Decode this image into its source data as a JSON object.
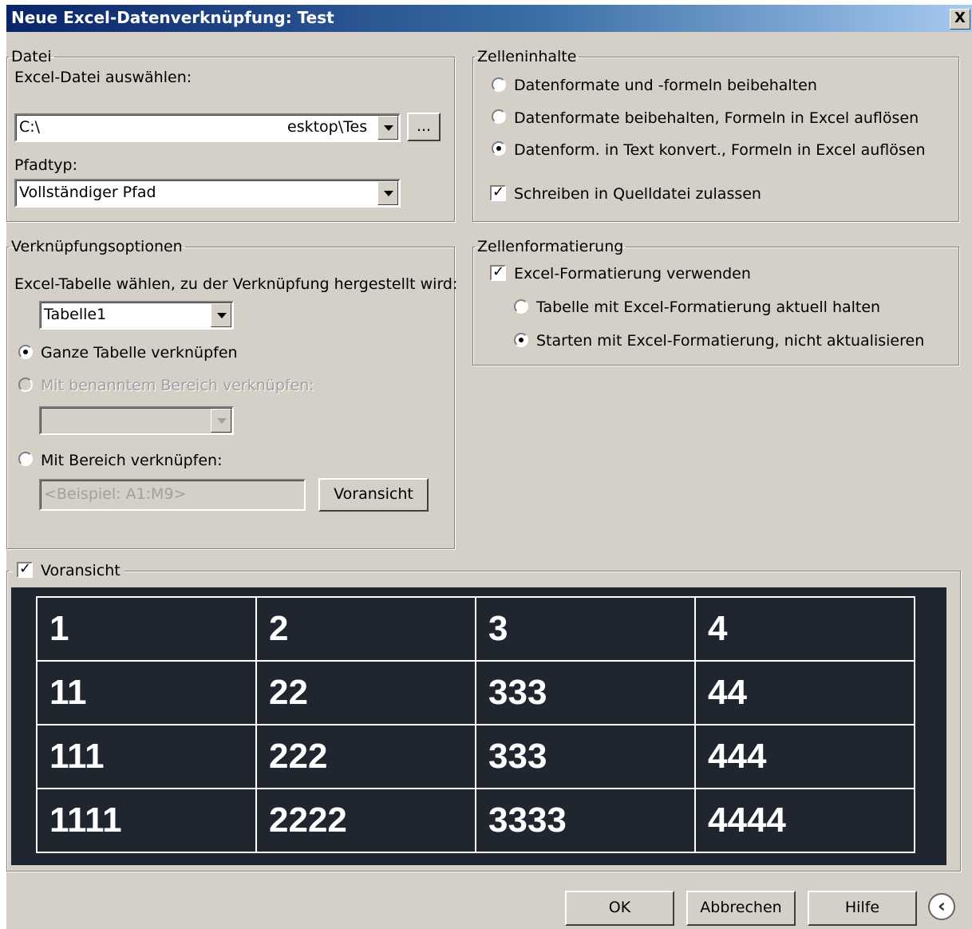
{
  "window": {
    "title": "Neue Excel-Datenverknüpfung: Test",
    "close_label": "X"
  },
  "datei": {
    "legend": "Datei",
    "select_label": "Excel-Datei auswählen:",
    "path_start": "C:\\",
    "path_end": "esktop\\Tes",
    "browse_label": "...",
    "pfadtyp_label": "Pfadtyp:",
    "pfadtyp_value": "Vollständiger Pfad"
  },
  "zelleninhalte": {
    "legend": "Zelleninhalte",
    "options": [
      {
        "label": "Datenformate und -formeln beibehalten",
        "selected": false
      },
      {
        "label": "Datenformate beibehalten, Formeln in Excel auflösen",
        "selected": false
      },
      {
        "label": "Datenform. in Text konvert., Formeln in Excel auflösen",
        "selected": true
      }
    ],
    "write_source_label": "Schreiben in Quelldatei zulassen",
    "write_source_checked": true
  },
  "verknuepfung": {
    "legend": "Verknüpfungsoptionen",
    "table_label": "Excel-Tabelle wählen, zu der Verknüpfung hergestellt wird:",
    "table_value": "Tabelle1",
    "whole_table_label": "Ganze Tabelle verknüpfen",
    "named_range_label": "Mit benanntem Bereich verknüpfen:",
    "range_label": "Mit Bereich verknüpfen:",
    "range_placeholder": "<Beispiel: A1:M9>",
    "preview_button": "Voransicht"
  },
  "zellenformatierung": {
    "legend": "Zellenformatierung",
    "use_excel_label": "Excel-Formatierung verwenden",
    "use_excel_checked": true,
    "keep_current_label": "Tabelle mit Excel-Formatierung aktuell halten",
    "start_label": "Starten mit Excel-Formatierung, nicht aktualisieren"
  },
  "preview": {
    "label": "Voransicht",
    "checked": true,
    "rows": [
      [
        "1",
        "2",
        "3",
        "4"
      ],
      [
        "11",
        "22",
        "333",
        "44"
      ],
      [
        "111",
        "222",
        "333",
        "444"
      ],
      [
        "1111",
        "2222",
        "3333",
        "4444"
      ]
    ]
  },
  "buttons": {
    "ok": "OK",
    "cancel": "Abbrechen",
    "help": "Hilfe",
    "back_icon": "chevron-left-circle-icon"
  }
}
